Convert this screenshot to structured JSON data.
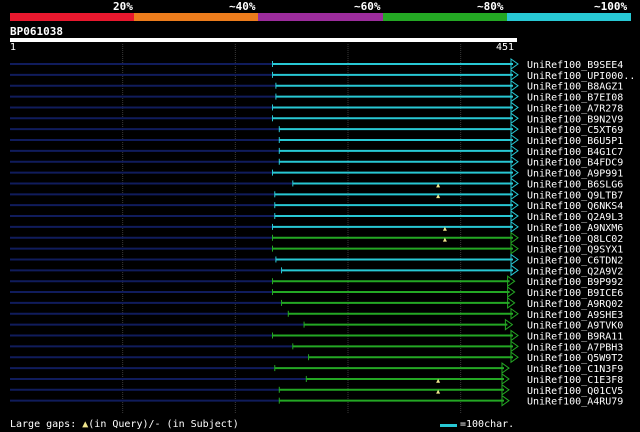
{
  "identity_legend": {
    "labels": [
      "20%",
      "~40%",
      "~60%",
      "~80%",
      "~100%"
    ],
    "colors": [
      "#e8182e",
      "#ec7c1c",
      "#9c2c9c",
      "#24a824",
      "#28c8d4"
    ]
  },
  "query": {
    "id": "BP061038",
    "start_label": "1",
    "end_label": "451",
    "length": 451
  },
  "hits": [
    {
      "name": "UniRef100_B9SEE4",
      "start": 234,
      "end": 451,
      "color": "cyan",
      "gap": null
    },
    {
      "name": "UniRef100_UPI000..",
      "start": 234,
      "end": 451,
      "color": "cyan",
      "gap": null
    },
    {
      "name": "UniRef100_B8AGZ1",
      "start": 237,
      "end": 451,
      "color": "cyan",
      "gap": null
    },
    {
      "name": "UniRef100_B7EI08",
      "start": 237,
      "end": 451,
      "color": "cyan",
      "gap": null
    },
    {
      "name": "UniRef100_A7R278",
      "start": 234,
      "end": 451,
      "color": "cyan",
      "gap": null
    },
    {
      "name": "UniRef100_B9N2V9",
      "start": 234,
      "end": 451,
      "color": "cyan",
      "gap": null
    },
    {
      "name": "UniRef100_C5XT69",
      "start": 240,
      "end": 451,
      "color": "cyan",
      "gap": null
    },
    {
      "name": "UniRef100_B6U5P1",
      "start": 240,
      "end": 451,
      "color": "cyan",
      "gap": null
    },
    {
      "name": "UniRef100_B4G1C7",
      "start": 240,
      "end": 451,
      "color": "cyan",
      "gap": null
    },
    {
      "name": "UniRef100_B4FDC9",
      "start": 240,
      "end": 451,
      "color": "cyan",
      "gap": null
    },
    {
      "name": "UniRef100_A9P991",
      "start": 234,
      "end": 451,
      "color": "cyan",
      "gap": null
    },
    {
      "name": "UniRef100_B6SLG6",
      "start": 252,
      "end": 451,
      "color": "cyan",
      "gap": null
    },
    {
      "name": "UniRef100_Q9LTB7",
      "start": 236,
      "end": 451,
      "color": "cyan",
      "gap": 381
    },
    {
      "name": "UniRef100_Q6NKS4",
      "start": 236,
      "end": 451,
      "color": "cyan",
      "gap": 381
    },
    {
      "name": "UniRef100_Q2A9L3",
      "start": 236,
      "end": 451,
      "color": "cyan",
      "gap": null
    },
    {
      "name": "UniRef100_A9NXM6",
      "start": 234,
      "end": 451,
      "color": "cyan",
      "gap": null
    },
    {
      "name": "UniRef100_Q8LC02",
      "start": 234,
      "end": 451,
      "color": "green",
      "gap": 387
    },
    {
      "name": "UniRef100_Q9SYX1",
      "start": 234,
      "end": 451,
      "color": "green",
      "gap": 387
    },
    {
      "name": "UniRef100_C6TDN2",
      "start": 237,
      "end": 451,
      "color": "cyan",
      "gap": null
    },
    {
      "name": "UniRef100_Q2A9V2",
      "start": 242,
      "end": 451,
      "color": "cyan",
      "gap": null
    },
    {
      "name": "UniRef100_B9P992",
      "start": 234,
      "end": 448,
      "color": "green",
      "gap": null
    },
    {
      "name": "UniRef100_B9ICE6",
      "start": 234,
      "end": 448,
      "color": "green",
      "gap": null
    },
    {
      "name": "UniRef100_A9RQ02",
      "start": 242,
      "end": 448,
      "color": "green",
      "gap": null
    },
    {
      "name": "UniRef100_A9SHE3",
      "start": 248,
      "end": 451,
      "color": "green",
      "gap": null
    },
    {
      "name": "UniRef100_A9TVK0",
      "start": 262,
      "end": 446,
      "color": "green",
      "gap": null
    },
    {
      "name": "UniRef100_B9RA11",
      "start": 234,
      "end": 451,
      "color": "green",
      "gap": null
    },
    {
      "name": "UniRef100_A7PBH3",
      "start": 252,
      "end": 451,
      "color": "green",
      "gap": null
    },
    {
      "name": "UniRef100_Q5W9T2",
      "start": 266,
      "end": 451,
      "color": "green",
      "gap": null
    },
    {
      "name": "UniRef100_C1N3F9",
      "start": 236,
      "end": 443,
      "color": "green",
      "gap": null
    },
    {
      "name": "UniRef100_C1E3F8",
      "start": 264,
      "end": 443,
      "color": "green",
      "gap": null
    },
    {
      "name": "UniRef100_Q01CV5",
      "start": 240,
      "end": 443,
      "color": "green",
      "gap": 381
    },
    {
      "name": "UniRef100_A4RU79",
      "start": 240,
      "end": 443,
      "color": "green",
      "gap": 381
    }
  ],
  "footer": {
    "large_gaps_prefix": "Large gaps: ",
    "large_gaps_query": "(in Query)/",
    "large_gaps_subject": "- (in Subject)",
    "scale_label": "=100char."
  },
  "colors": {
    "cyan": "#28c8d4",
    "green": "#24a824",
    "navy": "#101c5c",
    "grid": "#3a3a3a",
    "gap_marker": "#f0e68c"
  }
}
